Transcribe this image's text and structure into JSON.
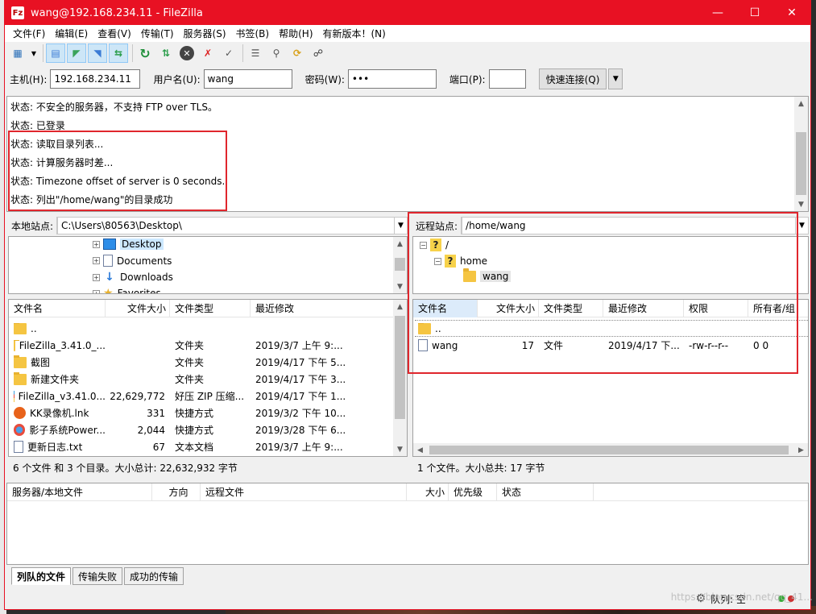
{
  "window": {
    "title": "wang@192.168.234.11 - FileZilla",
    "app_icon": "Fz"
  },
  "menu": [
    "文件(F)",
    "编辑(E)",
    "查看(V)",
    "传输(T)",
    "服务器(S)",
    "书签(B)",
    "帮助(H)",
    "有新版本！(N)"
  ],
  "quickconnect": {
    "host_label": "主机(H):",
    "host_value": "192.168.234.11",
    "user_label": "用户名(U):",
    "user_value": "wang",
    "pass_label": "密码(W):",
    "pass_value": "•••",
    "port_label": "端口(P):",
    "port_value": "",
    "connect_label": "快速连接(Q)"
  },
  "log": [
    "状态: 不安全的服务器，不支持 FTP over TLS。",
    "状态: 已登录",
    "状态: 读取目录列表...",
    "状态: 计算服务器时差...",
    "状态: Timezone offset of server is 0 seconds.",
    "状态: 列出\"/home/wang\"的目录成功"
  ],
  "local": {
    "site_label": "本地站点:",
    "path": "C:\\Users\\80563\\Desktop\\",
    "tree": [
      "Desktop",
      "Documents",
      "Downloads",
      "Favorites"
    ],
    "columns": [
      "文件名",
      "文件大小",
      "文件类型",
      "最近修改"
    ],
    "files": [
      {
        "name": "..",
        "size": "",
        "type": "",
        "modified": ""
      },
      {
        "name": "FileZilla_3.41.0_...",
        "size": "",
        "type": "文件夹",
        "modified": "2019/3/7 上午 9:..."
      },
      {
        "name": "截图",
        "size": "",
        "type": "文件夹",
        "modified": "2019/4/17 下午 5..."
      },
      {
        "name": "新建文件夹",
        "size": "",
        "type": "文件夹",
        "modified": "2019/4/17 下午 3..."
      },
      {
        "name": "FileZilla_v3.41.0...",
        "size": "22,629,772",
        "type": "好压 ZIP 压缩...",
        "modified": "2019/4/17 下午 1..."
      },
      {
        "name": "KK录像机.lnk",
        "size": "331",
        "type": "快捷方式",
        "modified": "2019/3/2 下午 10..."
      },
      {
        "name": "影子系统Power...",
        "size": "2,044",
        "type": "快捷方式",
        "modified": "2019/3/28 下午 6..."
      },
      {
        "name": "更新日志.txt",
        "size": "67",
        "type": "文本文档",
        "modified": "2019/3/7 上午 9:..."
      }
    ],
    "status": "6 个文件 和 3 个目录。大小总计: 22,632,932 字节"
  },
  "remote": {
    "site_label": "远程站点:",
    "path": "/home/wang",
    "tree": [
      "/",
      "home",
      "wang"
    ],
    "columns": [
      "文件名",
      "文件大小",
      "文件类型",
      "最近修改",
      "权限",
      "所有者/组"
    ],
    "files": [
      {
        "name": "..",
        "size": "",
        "type": "",
        "modified": "",
        "perms": "",
        "owner": ""
      },
      {
        "name": "wang",
        "size": "17",
        "type": "文件",
        "modified": "2019/4/17 下...",
        "perms": "-rw-r--r--",
        "owner": "0 0"
      }
    ],
    "status": "1 个文件。大小总共: 17 字节"
  },
  "queue": {
    "columns": [
      "服务器/本地文件",
      "方向",
      "远程文件",
      "大小",
      "优先级",
      "状态"
    ],
    "tabs": [
      "列队的文件",
      "传输失败",
      "成功的传输"
    ],
    "queue_label": "队列: 空"
  },
  "watermark": "https://blog.csdn.net/qq_41..."
}
